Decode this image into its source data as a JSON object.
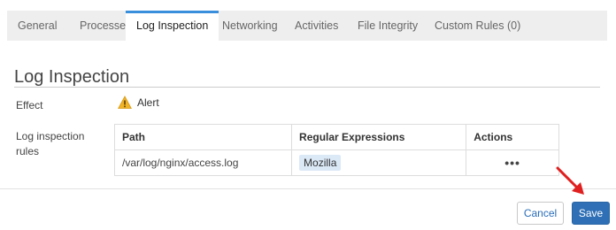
{
  "tabs": [
    {
      "label": "General",
      "active": false
    },
    {
      "label": "Processes",
      "active": false
    },
    {
      "label": "Log Inspection",
      "active": true
    },
    {
      "label": "Networking",
      "active": false
    },
    {
      "label": "Activities",
      "active": false
    },
    {
      "label": "File Integrity",
      "active": false
    },
    {
      "label": "Custom Rules (0)",
      "active": false
    }
  ],
  "section": {
    "title": "Log Inspection",
    "effect_label": "Effect",
    "effect_value": "Alert",
    "effect_icon": "warning-icon",
    "rules_label": "Log inspection rules"
  },
  "table": {
    "headers": {
      "path": "Path",
      "regex": "Regular Expressions",
      "actions": "Actions"
    },
    "rows": [
      {
        "path": "/var/log/nginx/access.log",
        "regex": "Mozilla",
        "actions": "•••"
      }
    ]
  },
  "buttons": {
    "cancel": "Cancel",
    "save": "Save"
  },
  "colors": {
    "accent": "#3a8fdc",
    "save_bg": "#2e6fb5",
    "warning": "#f0b429",
    "annotation_arrow": "#e02020"
  }
}
